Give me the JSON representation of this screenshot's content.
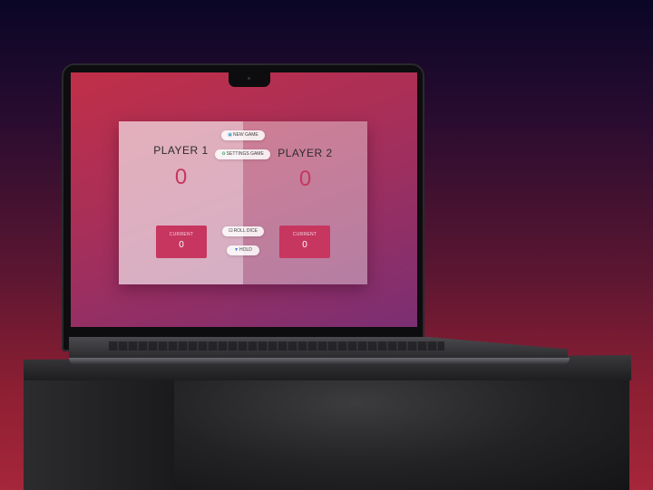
{
  "game": {
    "buttons": {
      "new_game": "NEW GAME",
      "settings": "SETTINGS GAME",
      "roll": "ROLL DICE",
      "hold": "HOLD"
    },
    "players": [
      {
        "name": "PLAYER 1",
        "score": "0",
        "current_label": "CURRENT",
        "current_value": "0"
      },
      {
        "name": "PLAYER 2",
        "score": "0",
        "current_label": "CURRENT",
        "current_value": "0"
      }
    ]
  },
  "colors": {
    "accent": "#c7365f",
    "screen_gradient_start": "#c12f48",
    "screen_gradient_end": "#7b2f73"
  },
  "icons": {
    "new_game": "refresh-icon",
    "settings": "recycle-icon",
    "roll": "dice-icon",
    "hold": "download-icon"
  }
}
